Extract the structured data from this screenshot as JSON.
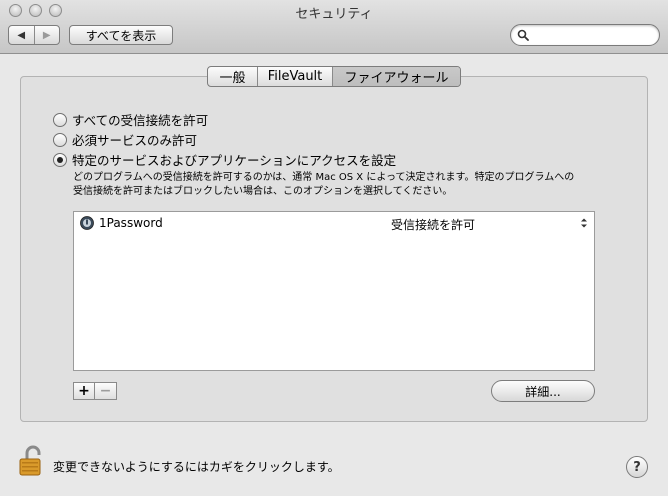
{
  "window": {
    "title": "セキュリティ"
  },
  "toolbar": {
    "back_icon": "◀",
    "forward_icon": "▶",
    "show_all_label": "すべてを表示",
    "search_placeholder": "",
    "search_value": ""
  },
  "tabs": [
    {
      "label": "一般",
      "selected": false
    },
    {
      "label": "FileVault",
      "selected": false
    },
    {
      "label": "ファイアウォール",
      "selected": true
    }
  ],
  "firewall": {
    "options": [
      {
        "label": "すべての受信接続を許可",
        "selected": false
      },
      {
        "label": "必須サービスのみ許可",
        "selected": false
      },
      {
        "label": "特定のサービスおよびアプリケーションにアクセスを設定",
        "selected": true
      }
    ],
    "description_line1": "どのプログラムへの受信接続を許可するのかは、通常 Mac OS X によって決定されます。特定のプログラムへの",
    "description_line2": "受信接続を許可またはブロックしたい場合は、このオプションを選択してください。",
    "apps": [
      {
        "name": "1Password",
        "setting": "受信接続を許可"
      }
    ],
    "add_label": "+",
    "remove_label": "−",
    "advanced_label": "詳細..."
  },
  "footer": {
    "lock_text": "変更できないようにするにはカギをクリックします。",
    "help_label": "?"
  }
}
